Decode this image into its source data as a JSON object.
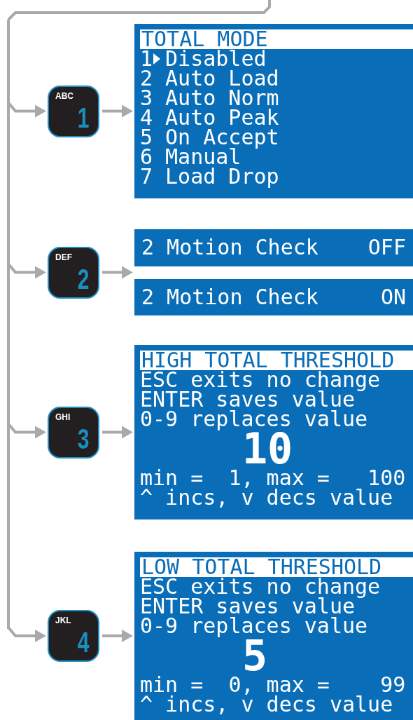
{
  "sections": [
    {
      "kind": "menu",
      "key": {
        "letters": "ABC",
        "digit": "1"
      },
      "title": "TOTAL MODE",
      "items": [
        {
          "number": "1",
          "label": "Disabled",
          "selected": true
        },
        {
          "number": "2",
          "label": "Auto Load",
          "selected": false
        },
        {
          "number": "3",
          "label": "Auto Norm",
          "selected": false
        },
        {
          "number": "4",
          "label": "Auto Peak",
          "selected": false
        },
        {
          "number": "5",
          "label": "On Accept",
          "selected": false
        },
        {
          "number": "6",
          "label": "Manual",
          "selected": false
        },
        {
          "number": "7",
          "label": "Load Drop",
          "selected": false
        }
      ]
    },
    {
      "kind": "toggle",
      "key": {
        "letters": "DEF",
        "digit": "2"
      },
      "screens": [
        {
          "label": "2 Motion Check",
          "value": "OFF"
        },
        {
          "label": "2 Motion Check",
          "value": "ON"
        }
      ]
    },
    {
      "kind": "entry",
      "key": {
        "letters": "GHI",
        "digit": "3"
      },
      "title": "HIGH TOTAL THRESHOLD",
      "lines": [
        "ESC exits no change",
        "ENTER saves value",
        "0-9 replaces value"
      ],
      "value": "10",
      "range": "min =  1, max =   100",
      "hint": "^ incs, v decs value"
    },
    {
      "kind": "entry",
      "key": {
        "letters": "JKL",
        "digit": "4"
      },
      "title": "LOW TOTAL THRESHOLD",
      "lines": [
        "ESC exits no change",
        "ENTER saves value",
        "0-9 replaces value"
      ],
      "value": "5",
      "range": "min =  0, max =    99",
      "hint": "^ incs, v decs value"
    }
  ]
}
